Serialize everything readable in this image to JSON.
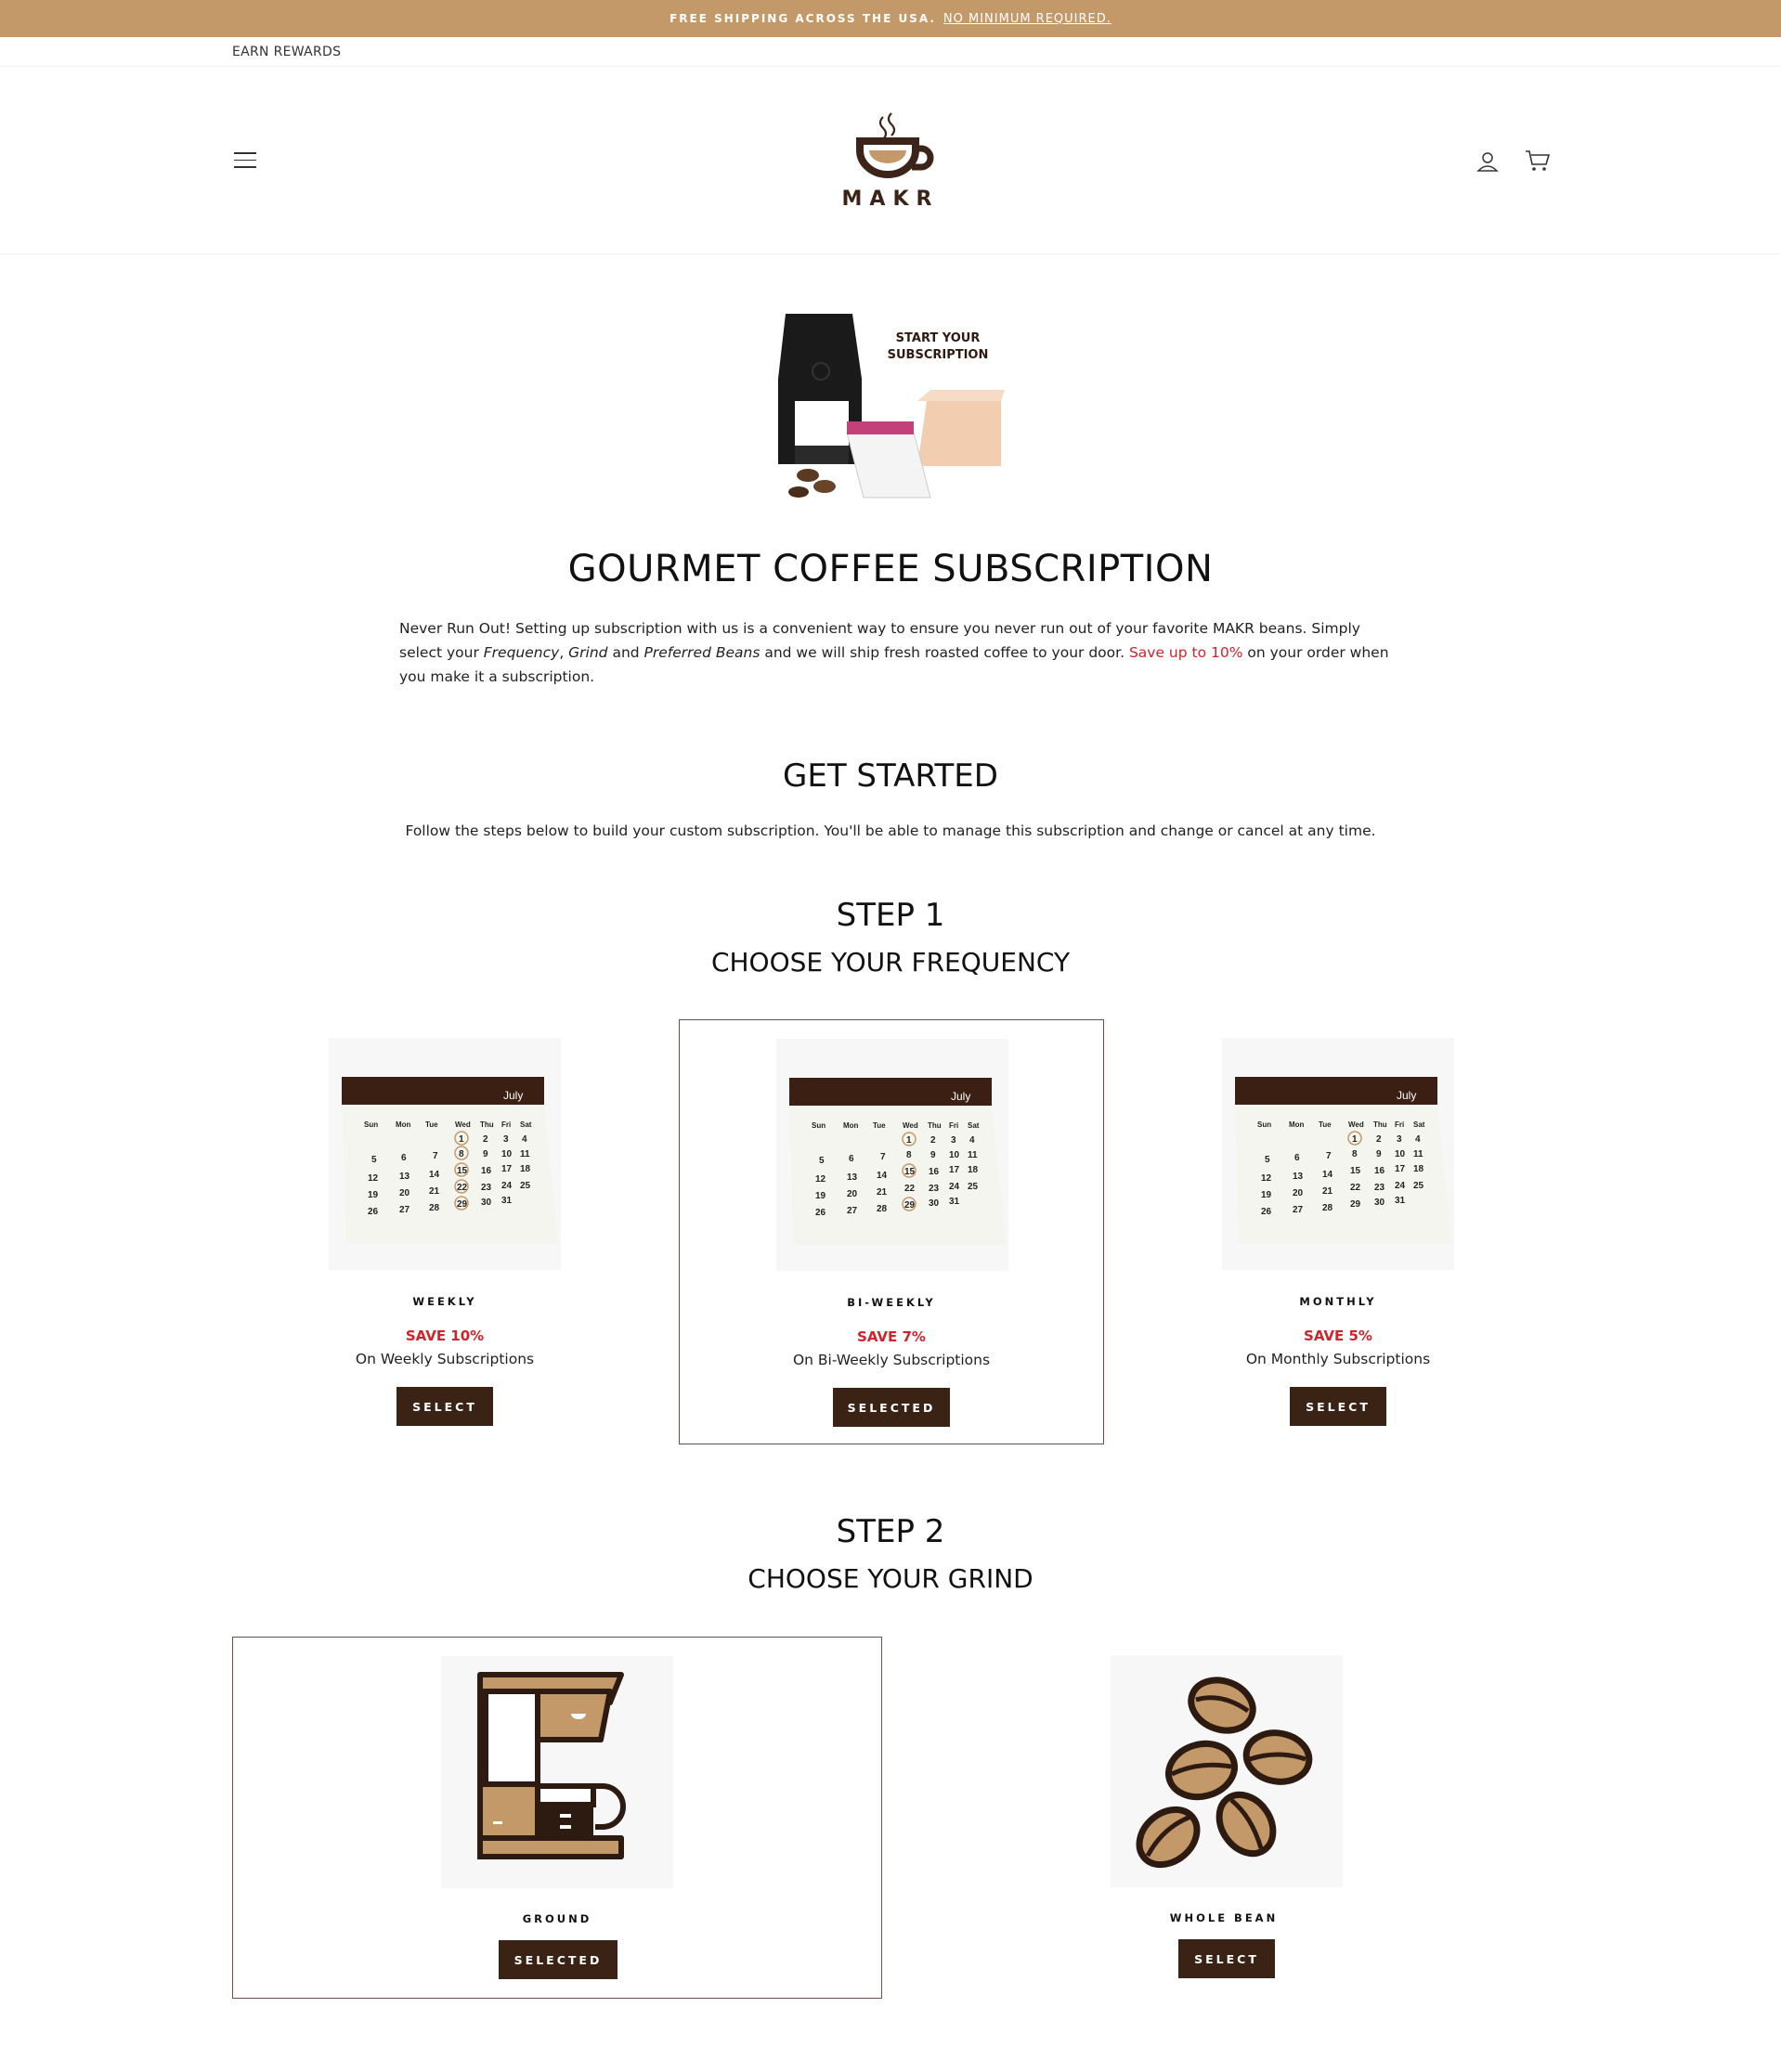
{
  "announcement": {
    "text": "FREE SHIPPING ACROSS THE USA.",
    "link": "NO MINIMUM REQUIRED."
  },
  "utility": {
    "rewards": "EARN REWARDS"
  },
  "header": {
    "brand": "MAKR"
  },
  "hero": {
    "caption": "START YOUR SUBSCRIPTION"
  },
  "page": {
    "title": "GOURMET COFFEE SUBSCRIPTION",
    "intro_1": "Never Run Out! Setting up subscription with us is a convenient way to ensure you never run out of your favorite MAKR beans. Simply select your ",
    "intro_em1": "Frequency",
    "intro_sep1": ", ",
    "intro_em2": "Grind",
    "intro_sep2": " and ",
    "intro_em3": "Preferred Beans",
    "intro_2": " and we will ship fresh roasted coffee to your door. ",
    "intro_red": "Save up to 10%",
    "intro_3": " on your order when you make it a subscription.",
    "get_started": "GET STARTED",
    "follow": "Follow the steps below to build your custom subscription. You'll be able to manage this subscription and change or cancel at any time."
  },
  "step1": {
    "number": "STEP 1",
    "title": "CHOOSE YOUR FREQUENCY",
    "options": [
      {
        "label": "WEEKLY",
        "save": "SAVE 10%",
        "sub": "On Weekly Subscriptions",
        "button": "SELECT"
      },
      {
        "label": "BI-WEEKLY",
        "save": "SAVE 7%",
        "sub": "On Bi-Weekly Subscriptions",
        "button": "SELECTED"
      },
      {
        "label": "MONTHLY",
        "save": "SAVE 5%",
        "sub": "On Monthly Subscriptions",
        "button": "SELECT"
      }
    ],
    "calendar": {
      "month": "July",
      "days": [
        "Sun",
        "Mon",
        "Tue",
        "Wed",
        "Thu",
        "Fri",
        "Sat"
      ]
    }
  },
  "step2": {
    "number": "STEP 2",
    "title": "CHOOSE YOUR GRIND",
    "options": [
      {
        "label": "GROUND",
        "button": "SELECTED"
      },
      {
        "label": "WHOLE BEAN",
        "button": "SELECT"
      }
    ]
  },
  "colors": {
    "accent": "#c4996a",
    "dark_brown": "#3a2314",
    "sale_red": "#d1232a"
  }
}
